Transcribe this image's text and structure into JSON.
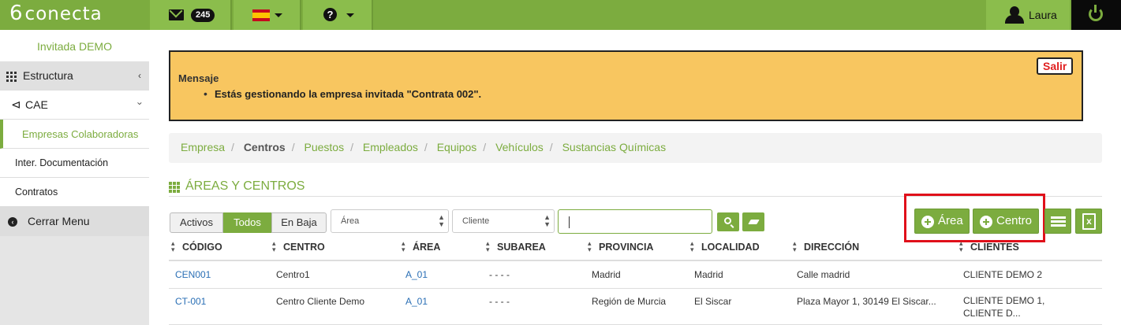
{
  "topbar": {
    "logo_mark": "6",
    "logo_text": "conecta",
    "mail_count": "245",
    "user_name": "Laura",
    "flag": "spain-flag"
  },
  "sidebar": {
    "user_label": "Invitada DEMO",
    "items": [
      {
        "label": "Estructura"
      },
      {
        "label": "CAE"
      },
      {
        "label": "Empresas Colaboradoras"
      },
      {
        "label": "Inter. Documentación"
      },
      {
        "label": "Contratos"
      },
      {
        "label": "Cerrar Menu"
      }
    ]
  },
  "message": {
    "title": "Mensaje",
    "text": "Estás gestionando la empresa invitada \"Contrata 002\".",
    "exit_label": "Salir"
  },
  "breadcrumb": [
    "Empresa",
    "Centros",
    "Puestos",
    "Empleados",
    "Equipos",
    "Vehículos",
    "Sustancias Químicas"
  ],
  "section_title": "ÁREAS Y CENTROS",
  "filters": {
    "status": [
      "Activos",
      "Todos",
      "En Baja"
    ],
    "active_status": "Todos",
    "area_placeholder": "Área",
    "client_placeholder": "Cliente",
    "search_value": ""
  },
  "actions": {
    "add_area": "Área",
    "add_center": "Centro"
  },
  "table": {
    "columns": [
      "CÓDIGO",
      "CENTRO",
      "ÁREA",
      "SUBAREA",
      "PROVINCIA",
      "LOCALIDAD",
      "DIRECCIÓN",
      "CLIENTES"
    ],
    "rows": [
      {
        "codigo": "CEN001",
        "centro": "Centro1",
        "area": "A_01",
        "subarea": "- - - -",
        "provincia": "Madrid",
        "localidad": "Madrid",
        "direccion": "Calle madrid",
        "clientes": [
          "CLIENTE DEMO 2"
        ]
      },
      {
        "codigo": "CT-001",
        "centro": "Centro Cliente Demo",
        "area": "A_01",
        "subarea": "- - - -",
        "provincia": "Región de Murcia",
        "localidad": "El Siscar",
        "direccion": "Plaza Mayor 1, 30149 El Siscar...",
        "clientes": [
          "CLIENTE DEMO 1,",
          "CLIENTE D..."
        ]
      }
    ]
  },
  "colors": {
    "brand": "#7cac3f",
    "warning": "#f8c660",
    "highlight": "#e0101a"
  }
}
